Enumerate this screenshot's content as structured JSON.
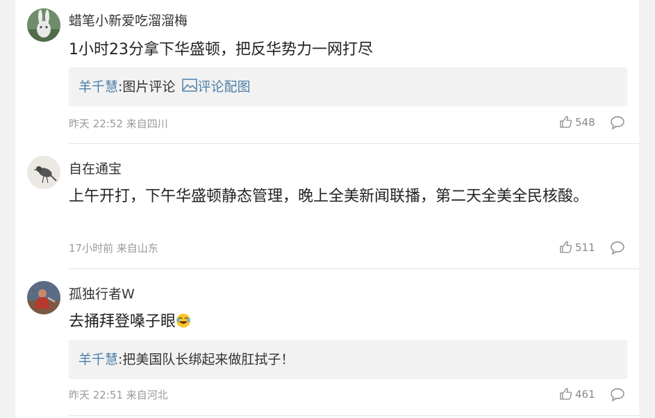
{
  "comments": [
    {
      "username": "蜡笔小新爱吃溜溜梅",
      "text": "1小时23分拿下华盛顿，把反华势力一网打尽",
      "reply_user": "羊千慧",
      "reply_text": ":图片评论 ",
      "reply_link": "评论配图",
      "meta": "昨天 22:52 来自四川",
      "likes": "548",
      "avatar_icon": "rabbit-avatar"
    },
    {
      "username": "自在通宝",
      "text": "上午开打，下午华盛顿静态管理，晚上全美新闻联播，第二天全美全民核酸。",
      "meta": "17小时前 来自山东",
      "likes": "511",
      "avatar_icon": "bird-avatar"
    },
    {
      "username": "孤独行者W",
      "text": "去捅拜登嗓子眼",
      "reply_user": "羊千慧",
      "reply_text": ":把美国队长绑起来做肛拭子！",
      "meta": "昨天 22:51 来自河北",
      "likes": "461",
      "avatar_icon": "figure-avatar",
      "emoji": "laughing-crying-emoji"
    }
  ],
  "colors": {
    "link": "#4e7faa",
    "meta": "#999999",
    "reply_bg": "#f2f2f2"
  }
}
